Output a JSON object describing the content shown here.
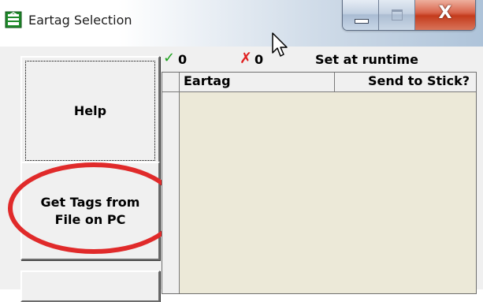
{
  "window": {
    "title": "Eartag Selection",
    "controls": [
      "minimize",
      "maximize",
      "close"
    ],
    "close_glyph": "X"
  },
  "icons": {
    "app": "eartag-app-icon",
    "check": "check-icon",
    "cross": "cross-icon",
    "cursor": "mouse-cursor"
  },
  "sidebar": {
    "help_label": "Help",
    "get_tags_line1": "Get Tags from",
    "get_tags_line2": "File on PC",
    "third_label": ""
  },
  "status": {
    "check_glyph": "✓",
    "selected_count": "0",
    "cross_glyph": "✗",
    "unselected_count": "0",
    "runtime_text": "Set at runtime"
  },
  "table": {
    "columns": [
      "Eartag",
      "Send to Stick?"
    ],
    "rows": []
  },
  "colors": {
    "highlight_circle": "#e02a2a",
    "check": "#1da11d",
    "cross": "#e02020",
    "grid_bg": "#ece9d8"
  }
}
